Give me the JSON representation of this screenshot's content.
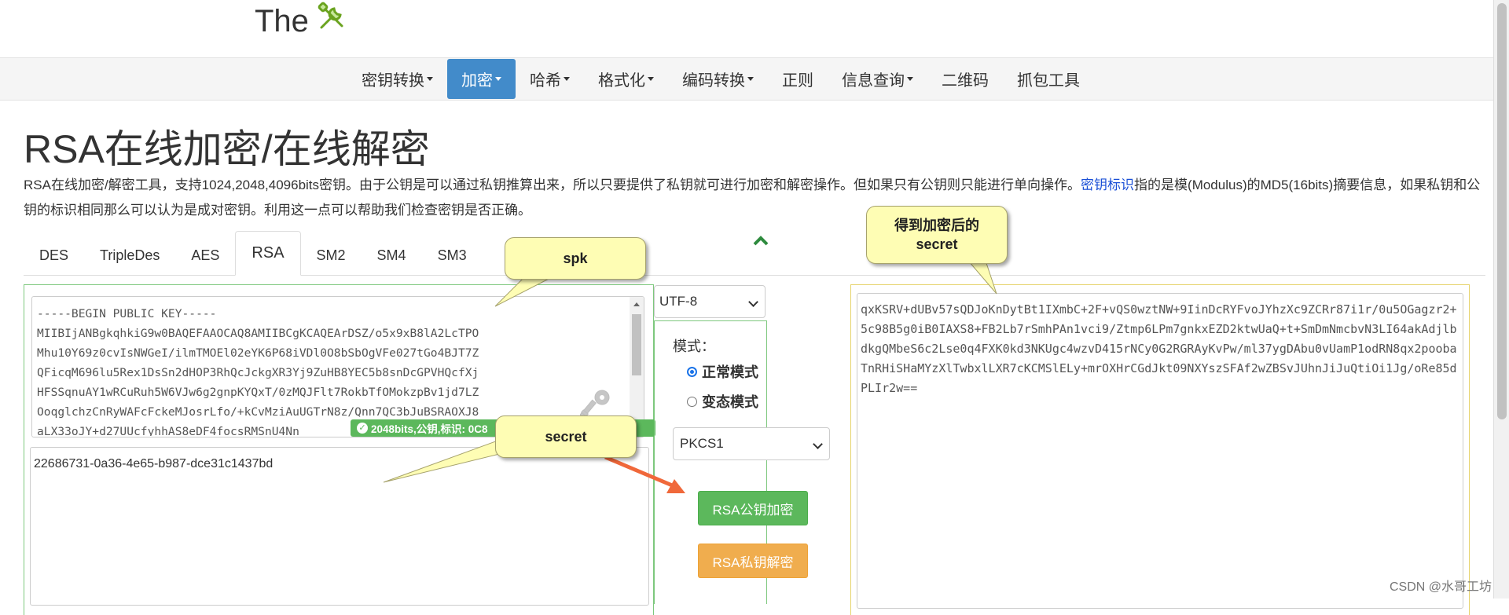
{
  "header": {
    "logo_text": "The"
  },
  "nav": {
    "items": [
      {
        "label": "密钥转换",
        "dropdown": true,
        "active": false
      },
      {
        "label": "加密",
        "dropdown": true,
        "active": true
      },
      {
        "label": "哈希",
        "dropdown": true,
        "active": false
      },
      {
        "label": "格式化",
        "dropdown": true,
        "active": false
      },
      {
        "label": "编码转换",
        "dropdown": true,
        "active": false
      },
      {
        "label": "正则",
        "dropdown": false,
        "active": false
      },
      {
        "label": "信息查询",
        "dropdown": true,
        "active": false
      },
      {
        "label": "二维码",
        "dropdown": false,
        "active": false
      },
      {
        "label": "抓包工具",
        "dropdown": false,
        "active": false
      }
    ]
  },
  "page": {
    "title": "RSA在线加密/在线解密",
    "desc_before_link": "RSA在线加密/解密工具，支持1024,2048,4096bits密钥。由于公钥是可以通过私钥推算出来，所以只要提供了私钥就可进行加密和解密操作。但如果只有公钥则只能进行单向操作。",
    "desc_link": "密钥标识",
    "desc_after_link": "指的是模(Modulus)的MD5(16bits)摘要信息，如果私钥和公钥的标识相同那么可以认为是成对密钥。利用这一点可以帮助我们检查密钥是否正确。"
  },
  "tabs": [
    {
      "label": "DES",
      "active": false
    },
    {
      "label": "TripleDes",
      "active": false
    },
    {
      "label": "AES",
      "active": false
    },
    {
      "label": "RSA",
      "active": true
    },
    {
      "label": "SM2",
      "active": false
    },
    {
      "label": "SM4",
      "active": false
    },
    {
      "label": "SM3",
      "active": false
    }
  ],
  "key_input": {
    "value": "-----BEGIN PUBLIC KEY-----\nMIIBIjANBgkqhkiG9w0BAQEFAAOCAQ8AMIIBCgKCAQEArDSZ/o5x9xB8lA2LcTPO\nMhu10Y69z0cvIsNWGeI/ilmTMOEl02eYK6P68iVDl0O8bSbOgVFe027tGo4BJT7Z\nQFicqM696lu5Rex1DsSn2dHOP3RhQcJckgXR3Yj9ZuHB8YEC5b8snDcGPVHQcfXj\nHFSSqnuAY1wRCuRuh5W6VJw6g2gnpKYQxT/0zMQJFlt7RokbTfOMokzpBv1jd7LZ\nOoqglchzCnRyWAFcFckeMJosrLfo/+kCvMziAuUGTrN8z/Qnn7QC3bJuBSRAOXJ8\naLX33oJY+d27UUcfyhhAS8eDF4focsRMSnU4Nn",
    "badge": "2048bits,公钥,标识: 0C8"
  },
  "data_input": {
    "value": "22686731-0a36-4e65-b987-dce31c1437bd"
  },
  "controls": {
    "charset": "UTF-8",
    "mode_label": "模式：",
    "mode_normal": "正常模式",
    "mode_variant": "变态模式",
    "padding": "PKCS1",
    "encrypt_label": "RSA公钥加密",
    "decrypt_label": "RSA私钥解密"
  },
  "output": {
    "value": "qxKSRV+dUBv57sQDJoKnDytBt1IXmbC+2F+vQS0wztNW+9IinDcRYFvoJYhzXc9ZCRr87i1r/0u5OGagzr2+5c98B5g0iB0IAXS8+FB2Lb7rSmhPAn1vci9/Ztmp6LPm7gnkxEZD2ktwUaQ+t+SmDmNmcbvN3LI64akAdjlbdkgQMbeS6c2Lse0q4FXK0kd3NKUgc4wzvD415rNCy0G2RGRAyKvPw/ml37ygDAbu0vUamP1odRN8qx2poobaTnRHiSHaMYzXlTwbxlLXR7cKCMSlELy+mrOXHrCGdJkt09NXYszSFAf2wZBSvJUhnJiJuQtiOi1Jg/oRe85dPLIr2w=="
  },
  "annotations": {
    "spk": "spk",
    "secret": "secret",
    "result_line1": "得到加密后的",
    "result_line2": "secret"
  },
  "watermark": "CSDN @水哥工坊",
  "colors": {
    "nav_active": "#428bca",
    "encrypt_button": "#5cb85c",
    "decrypt_button": "#f0ad4e",
    "callout_fill": "#fefdb4",
    "arrow": "#f0683a"
  },
  "icons": [
    "tools-icon",
    "chevron-up-icon",
    "check-circle-icon",
    "key-icon",
    "chevron-down-icon"
  ]
}
